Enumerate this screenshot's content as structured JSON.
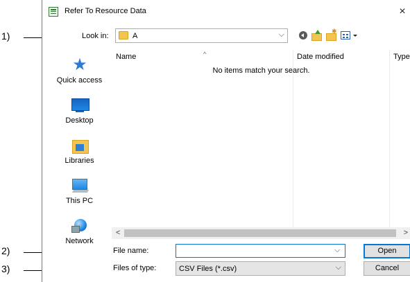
{
  "callouts": [
    "1)",
    "2)",
    "3)"
  ],
  "dialog": {
    "title": "Refer To Resource Data",
    "close_glyph": "×"
  },
  "look_in": {
    "label": "Look in:",
    "value": "A",
    "chevron": "⌵"
  },
  "toolbar": [
    "back-icon",
    "up-folder-icon",
    "new-folder-icon",
    "views-menu-icon"
  ],
  "places": [
    {
      "label": "Quick access",
      "icon": "quick-access-icon"
    },
    {
      "label": "Desktop",
      "icon": "desktop-icon"
    },
    {
      "label": "Libraries",
      "icon": "libraries-icon"
    },
    {
      "label": "This PC",
      "icon": "this-pc-icon"
    },
    {
      "label": "Network",
      "icon": "network-icon"
    }
  ],
  "file_list": {
    "columns": [
      "Name",
      "Date modified",
      "Type"
    ],
    "sort_indicator": "^",
    "empty_message": "No items match your search.",
    "scroll_left": "<",
    "scroll_right": ">"
  },
  "file_name": {
    "label": "File name:",
    "value": "",
    "chevron": "⌵"
  },
  "file_type": {
    "label": "Files of type:",
    "value": "CSV Files (*.csv)",
    "chevron": "⌵"
  },
  "buttons": {
    "open": "Open",
    "cancel": "Cancel"
  }
}
